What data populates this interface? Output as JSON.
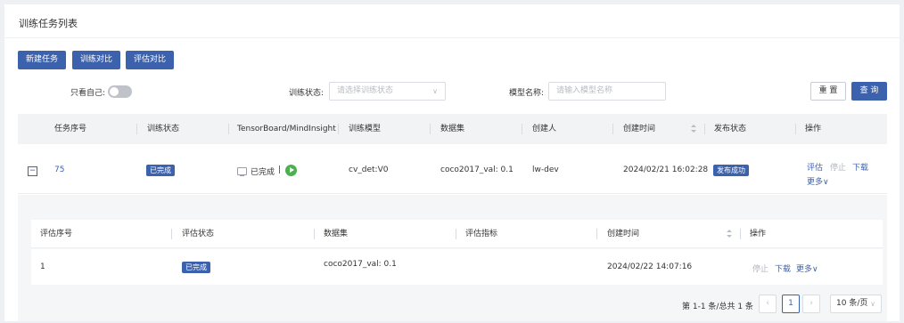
{
  "page": {
    "title": "训练任务列表"
  },
  "toolbar": {
    "new_task": "新建任务",
    "train_compare": "训练对比",
    "eval_compare": "评估对比"
  },
  "filters": {
    "only_mine_label": "只看自己:",
    "only_mine_on": false,
    "train_status_label": "训练状态:",
    "train_status_placeholder": "请选择训练状态",
    "model_name_label": "模型名称:",
    "model_name_placeholder": "请输入模型名称",
    "reset": "重 置",
    "query": "查 询"
  },
  "table": {
    "headers": [
      "任务序号",
      "训练状态",
      "TensorBoard/MindInsight",
      "训练模型",
      "数据集",
      "创建人",
      "创建时间",
      "发布状态",
      "操作"
    ],
    "rows": [
      {
        "expand_symbol": "−",
        "id": "75",
        "train_status": "已完成",
        "tb_status": "已完成",
        "tb_sep": "|",
        "model": "cv_det:V0",
        "dataset": "coco2017_val: 0.1",
        "creator": "lw-dev",
        "created_at": "2024/02/21 16:02:28",
        "publish_status": "发布成功",
        "actions": {
          "evaluate": "评估",
          "stop": "停止",
          "download": "下载",
          "more": "更多∨"
        }
      }
    ]
  },
  "sub_table": {
    "headers": [
      "评估序号",
      "评估状态",
      "数据集",
      "评估指标",
      "创建时间",
      "操作"
    ],
    "rows": [
      {
        "id": "1",
        "status": "已完成",
        "dataset": "coco2017_val: 0.1",
        "metric": "",
        "created_at": "2024/02/22 14:07:16",
        "actions": {
          "stop": "停止",
          "download": "下载",
          "more": "更多∨"
        }
      }
    ]
  },
  "pagination": {
    "summary": "第 1-1 条/总共 1 条",
    "prev": "‹",
    "current": "1",
    "next": "›",
    "page_size": "10 条/页"
  },
  "colors": {
    "primary": "#3d62ad",
    "success": "#4caf50",
    "panel_bg": "#f5f6f8"
  }
}
